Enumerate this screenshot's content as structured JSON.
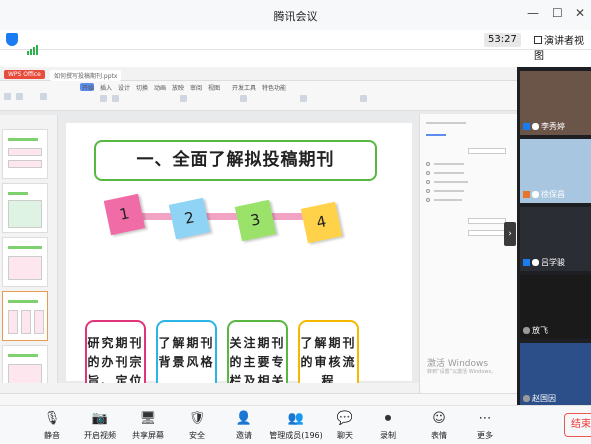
{
  "window": {
    "title": "腾讯会议",
    "minimize": "—",
    "maximize": "☐",
    "close": "✕"
  },
  "meeting": {
    "timer": "53:27",
    "view_toggle": "演讲者视图",
    "accent": "#1a7cf2"
  },
  "wps": {
    "tabs": [
      "WPS Office",
      "如何撰写投稿期刊.pptx"
    ],
    "menu": [
      "开始",
      "插入",
      "设计",
      "切换",
      "动画",
      "放映",
      "审阅",
      "视图",
      "开发工具",
      "特色功能"
    ]
  },
  "slide": {
    "title": "一、全面了解拟投稿期刊",
    "nodes": [
      {
        "label": "1",
        "color": "#f06ca6"
      },
      {
        "label": "2",
        "color": "#8fd3f5"
      },
      {
        "label": "3",
        "color": "#9be26a"
      },
      {
        "label": "4",
        "color": "#ffd24a"
      }
    ],
    "cards": [
      {
        "text": "研究期刊的办刊宗旨、定位和投稿要求",
        "border": "#e0357a"
      },
      {
        "text": "了解期刊背景风格",
        "border": "#2bb5e6"
      },
      {
        "text": "关注期刊的主要专栏及相关文章",
        "border": "#58b741"
      },
      {
        "text": "了解期刊的审核流程",
        "border": "#f5b800"
      }
    ]
  },
  "watermark": {
    "line1": "激活 Windows",
    "line2": "转到“设置”以激活 Windows。"
  },
  "participants": [
    {
      "name": "李秀婷",
      "photo_color": "#6b5448"
    },
    {
      "name": "徐保昌",
      "photo_color": "#a8c6e0"
    },
    {
      "name": "吕学骏",
      "photo_color": "#2a2d33"
    },
    {
      "name": "放飞",
      "photo_color": "#1a1a1a"
    },
    {
      "name": "赵国因",
      "photo_color": "#2c4f8a"
    }
  ],
  "toolbar": {
    "buttons": [
      {
        "label": "静音",
        "icon": "microphone-icon",
        "glyph": "🎙"
      },
      {
        "label": "开启视频",
        "icon": "camera-off-icon",
        "glyph": "📷"
      },
      {
        "label": "共享屏幕",
        "icon": "share-screen-icon",
        "glyph": "🖥"
      },
      {
        "label": "安全",
        "icon": "shield-icon",
        "glyph": "🛡"
      },
      {
        "label": "邀请",
        "icon": "invite-icon",
        "glyph": "👤"
      },
      {
        "label": "管理成员(196)",
        "icon": "members-icon",
        "glyph": "👥"
      },
      {
        "label": "聊天",
        "icon": "chat-icon",
        "glyph": "💬"
      },
      {
        "label": "录制",
        "icon": "record-icon",
        "glyph": "⏺"
      },
      {
        "label": "表情",
        "icon": "emoji-icon",
        "glyph": "☺"
      },
      {
        "label": "更多",
        "icon": "more-icon",
        "glyph": "⋯"
      }
    ],
    "end_label": "结束"
  }
}
